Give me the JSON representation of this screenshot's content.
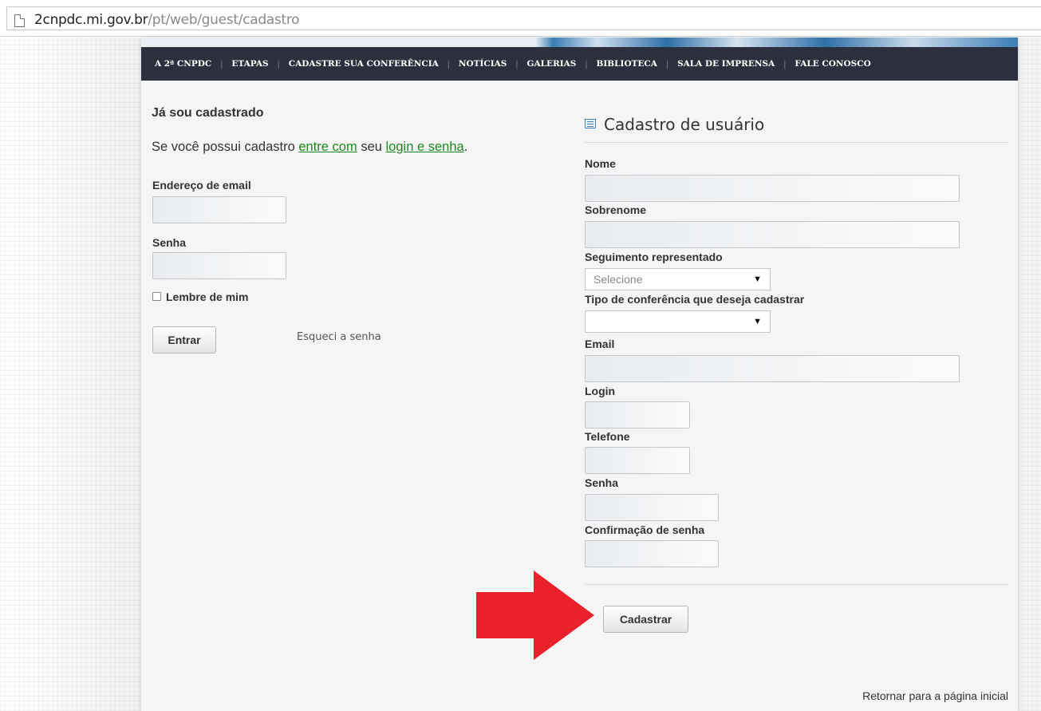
{
  "browser": {
    "url_host": "2cnpdc.mi.gov.br",
    "url_path": "/pt/web/guest/cadastro"
  },
  "nav": {
    "items": [
      "A 2ª CNPDC",
      "ETAPAS",
      "CADASTRE SUA CONFERÊNCIA",
      "NOTÍCIAS",
      "GALERIAS",
      "BIBLIOTECA",
      "SALA DE IMPRENSA",
      "FALE CONOSCO"
    ],
    "separator": "|"
  },
  "login": {
    "title": "Já sou cadastrado",
    "intro_prefix": "Se você possui cadastro ",
    "intro_link1": "entre com",
    "intro_middle": " seu ",
    "intro_link2": "login e senha",
    "intro_suffix": ".",
    "email_label": "Endereço de email",
    "email_value": "",
    "password_label": "Senha",
    "password_value": "",
    "remember_label": "Lembre de mim",
    "remember_checked": false,
    "submit_label": "Entrar",
    "forgot_label": "Esqueci a senha"
  },
  "register": {
    "title": "Cadastro de usuário",
    "fields": {
      "nome_label": "Nome",
      "sobrenome_label": "Sobrenome",
      "seguimento_label": "Seguimento representado",
      "seguimento_selected": "Selecione",
      "tipo_label": "Tipo de conferência que deseja cadastrar",
      "tipo_selected": "",
      "email_label": "Email",
      "login_label": "Login",
      "telefone_label": "Telefone",
      "senha_label": "Senha",
      "confirmacao_label": "Confirmação de senha"
    },
    "submit_label": "Cadastrar"
  },
  "footer": {
    "return_link": "Retornar para a página inicial"
  },
  "colors": {
    "nav_bg": "#2c2f3d",
    "link_green": "#1a8a1a",
    "annotation_arrow": "#e8212b"
  }
}
